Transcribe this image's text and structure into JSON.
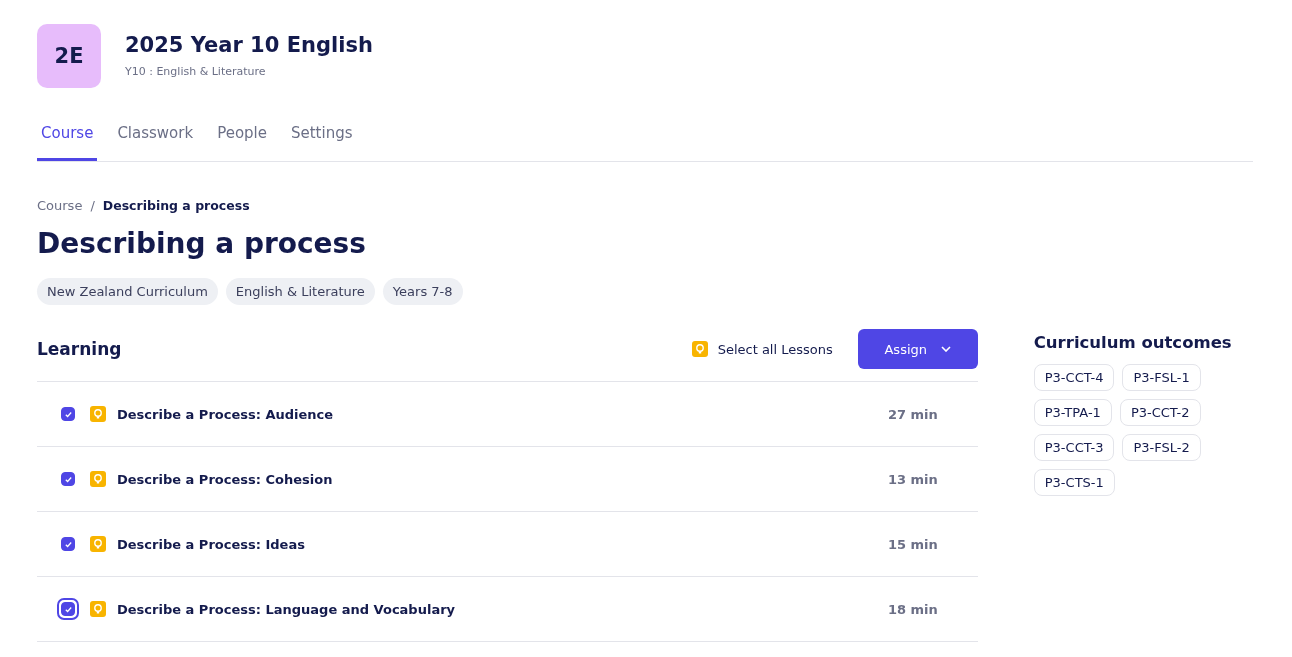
{
  "course": {
    "avatar": "2E",
    "title": "2025 Year 10 English",
    "subtitle": "Y10 : English & Literature"
  },
  "tabs": [
    {
      "label": "Course",
      "selected": true
    },
    {
      "label": "Classwork",
      "selected": false
    },
    {
      "label": "People",
      "selected": false
    },
    {
      "label": "Settings",
      "selected": false
    }
  ],
  "breadcrumb": [
    "Course",
    "Describing a process"
  ],
  "breadcrumb_separator": "/",
  "page_title": "Describing a process",
  "tags": [
    "New Zealand Curriculum",
    "English & Literature",
    "Years 7-8"
  ],
  "learning": {
    "heading": "Learning",
    "select_all": "Select all Lessons",
    "assign_button": "Assign",
    "lessons": [
      {
        "title": "Describe a Process: Audience",
        "duration": "27 min",
        "checked": true,
        "focused": false
      },
      {
        "title": "Describe a Process: Cohesion",
        "duration": "13 min",
        "checked": true,
        "focused": false
      },
      {
        "title": "Describe a Process: Ideas",
        "duration": "15 min",
        "checked": true,
        "focused": false
      },
      {
        "title": "Describe a Process: Language and Vocabulary",
        "duration": "18 min",
        "checked": true,
        "focused": true
      }
    ]
  },
  "outcomes": {
    "heading": "Curriculum outcomes",
    "items": [
      "P3-CCT-4",
      "P3-FSL-1",
      "P3-TPA-1",
      "P3-CCT-2",
      "P3-CCT-3",
      "P3-FSL-2",
      "P3-CTS-1"
    ]
  }
}
